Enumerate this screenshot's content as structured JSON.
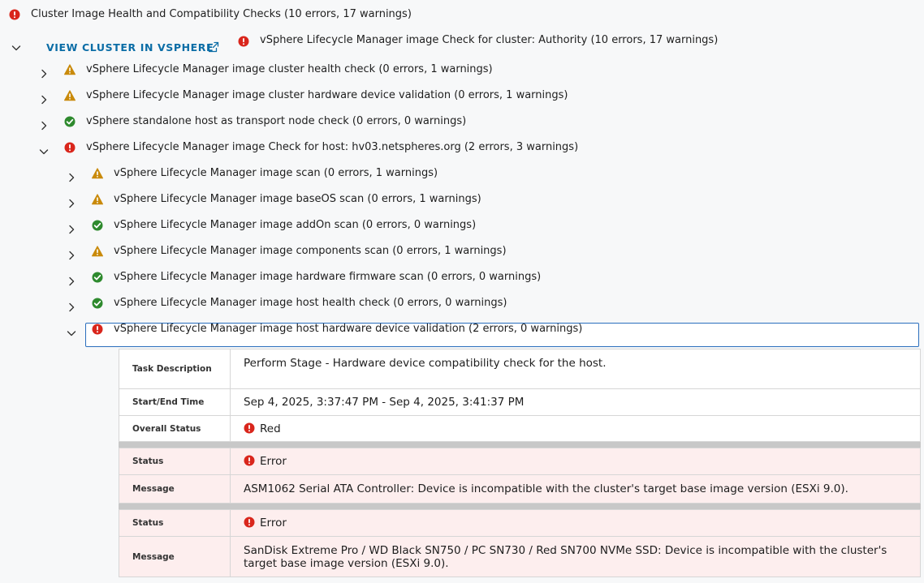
{
  "header": {
    "title": "Cluster Image Health and Compatibility Checks (10 errors, 17 warnings)",
    "link_label": "VIEW CLUSTER IN VSPHERE",
    "cluster_check": "vSphere Lifecycle Manager image Check for cluster: Authority (10 errors, 17 warnings)"
  },
  "level1": [
    {
      "status": "warning",
      "label": "vSphere Lifecycle Manager image cluster health check (0 errors, 1 warnings)"
    },
    {
      "status": "warning",
      "label": "vSphere Lifecycle Manager image cluster hardware device validation (0 errors, 1 warnings)"
    },
    {
      "status": "success",
      "label": "vSphere standalone host as transport node check (0 errors, 0 warnings)"
    },
    {
      "status": "error",
      "label": "vSphere Lifecycle Manager image Check for host: hv03.netspheres.org (2 errors, 3 warnings)"
    }
  ],
  "level2": [
    {
      "status": "warning",
      "label": "vSphere Lifecycle Manager image scan (0 errors, 1 warnings)"
    },
    {
      "status": "warning",
      "label": "vSphere Lifecycle Manager image baseOS scan (0 errors, 1 warnings)"
    },
    {
      "status": "success",
      "label": "vSphere Lifecycle Manager image addOn scan (0 errors, 0 warnings)"
    },
    {
      "status": "warning",
      "label": "vSphere Lifecycle Manager image components scan (0 errors, 1 warnings)"
    },
    {
      "status": "success",
      "label": "vSphere Lifecycle Manager image hardware firmware scan (0 errors, 0 warnings)"
    },
    {
      "status": "success",
      "label": "vSphere Lifecycle Manager image host health check (0 errors, 0 warnings)"
    },
    {
      "status": "error",
      "label": "vSphere Lifecycle Manager image host hardware device validation (2 errors, 0 warnings)"
    }
  ],
  "details": {
    "task_description_key": "Task Description",
    "task_description": "Perform Stage - Hardware device compatibility check for the host.",
    "start_end_key": "Start/End Time",
    "start_end": "Sep 4, 2025, 3:37:47 PM - Sep 4, 2025, 3:41:37 PM",
    "overall_status_key": "Overall Status",
    "overall_status": "Red",
    "issues": [
      {
        "status_key": "Status",
        "status": "Error",
        "message_key": "Message",
        "message": "ASM1062 Serial ATA Controller: Device is incompatible with the cluster's target base image version (ESXi 9.0)."
      },
      {
        "status_key": "Status",
        "status": "Error",
        "message_key": "Message",
        "message": "SanDisk Extreme Pro / WD Black SN750 / PC SN730 / Red SN700 NVMe SSD: Device is incompatible with the cluster's target base image version (ESXi 9.0)."
      }
    ]
  },
  "colors": {
    "error": "#d9261c",
    "warning": "#c98a0b",
    "success": "#2e8a2e",
    "link": "#0b6da6",
    "focus": "#2a6ebd",
    "error_row_bg": "#fdeeee"
  }
}
